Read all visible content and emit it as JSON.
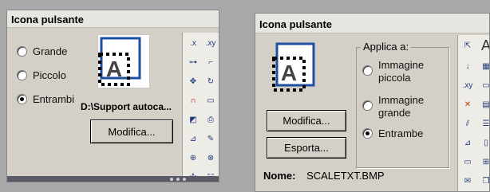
{
  "left_panel": {
    "title": "Icona pulsante",
    "radios": [
      {
        "label": "Grande",
        "checked": false
      },
      {
        "label": "Piccolo",
        "checked": false
      },
      {
        "label": "Entrambi",
        "checked": true
      }
    ],
    "path": "D:\\Support autoca...",
    "modify_button": "Modifica..."
  },
  "right_panel": {
    "title": "Icona pulsante",
    "group_label": "Applica a:",
    "radios": [
      {
        "label": "Immagine piccola",
        "checked": false
      },
      {
        "label": "Immagine grande",
        "checked": false
      },
      {
        "label": "Entrambe",
        "checked": true
      }
    ],
    "modify_button": "Modifica...",
    "export_button": "Esporta...",
    "name_label": "Nome:",
    "name_value": "SCALETXT.BMP"
  },
  "preview_glyph": "A",
  "toolbar_left": [
    ".x",
    ".xy"
  ],
  "toolbar_right": [
    ".xy",
    "A"
  ],
  "colors": {
    "panel_bg": "#d4d0c8",
    "desktop_bg": "#a9a9a9",
    "icon_blue": "#1f4fa0"
  }
}
